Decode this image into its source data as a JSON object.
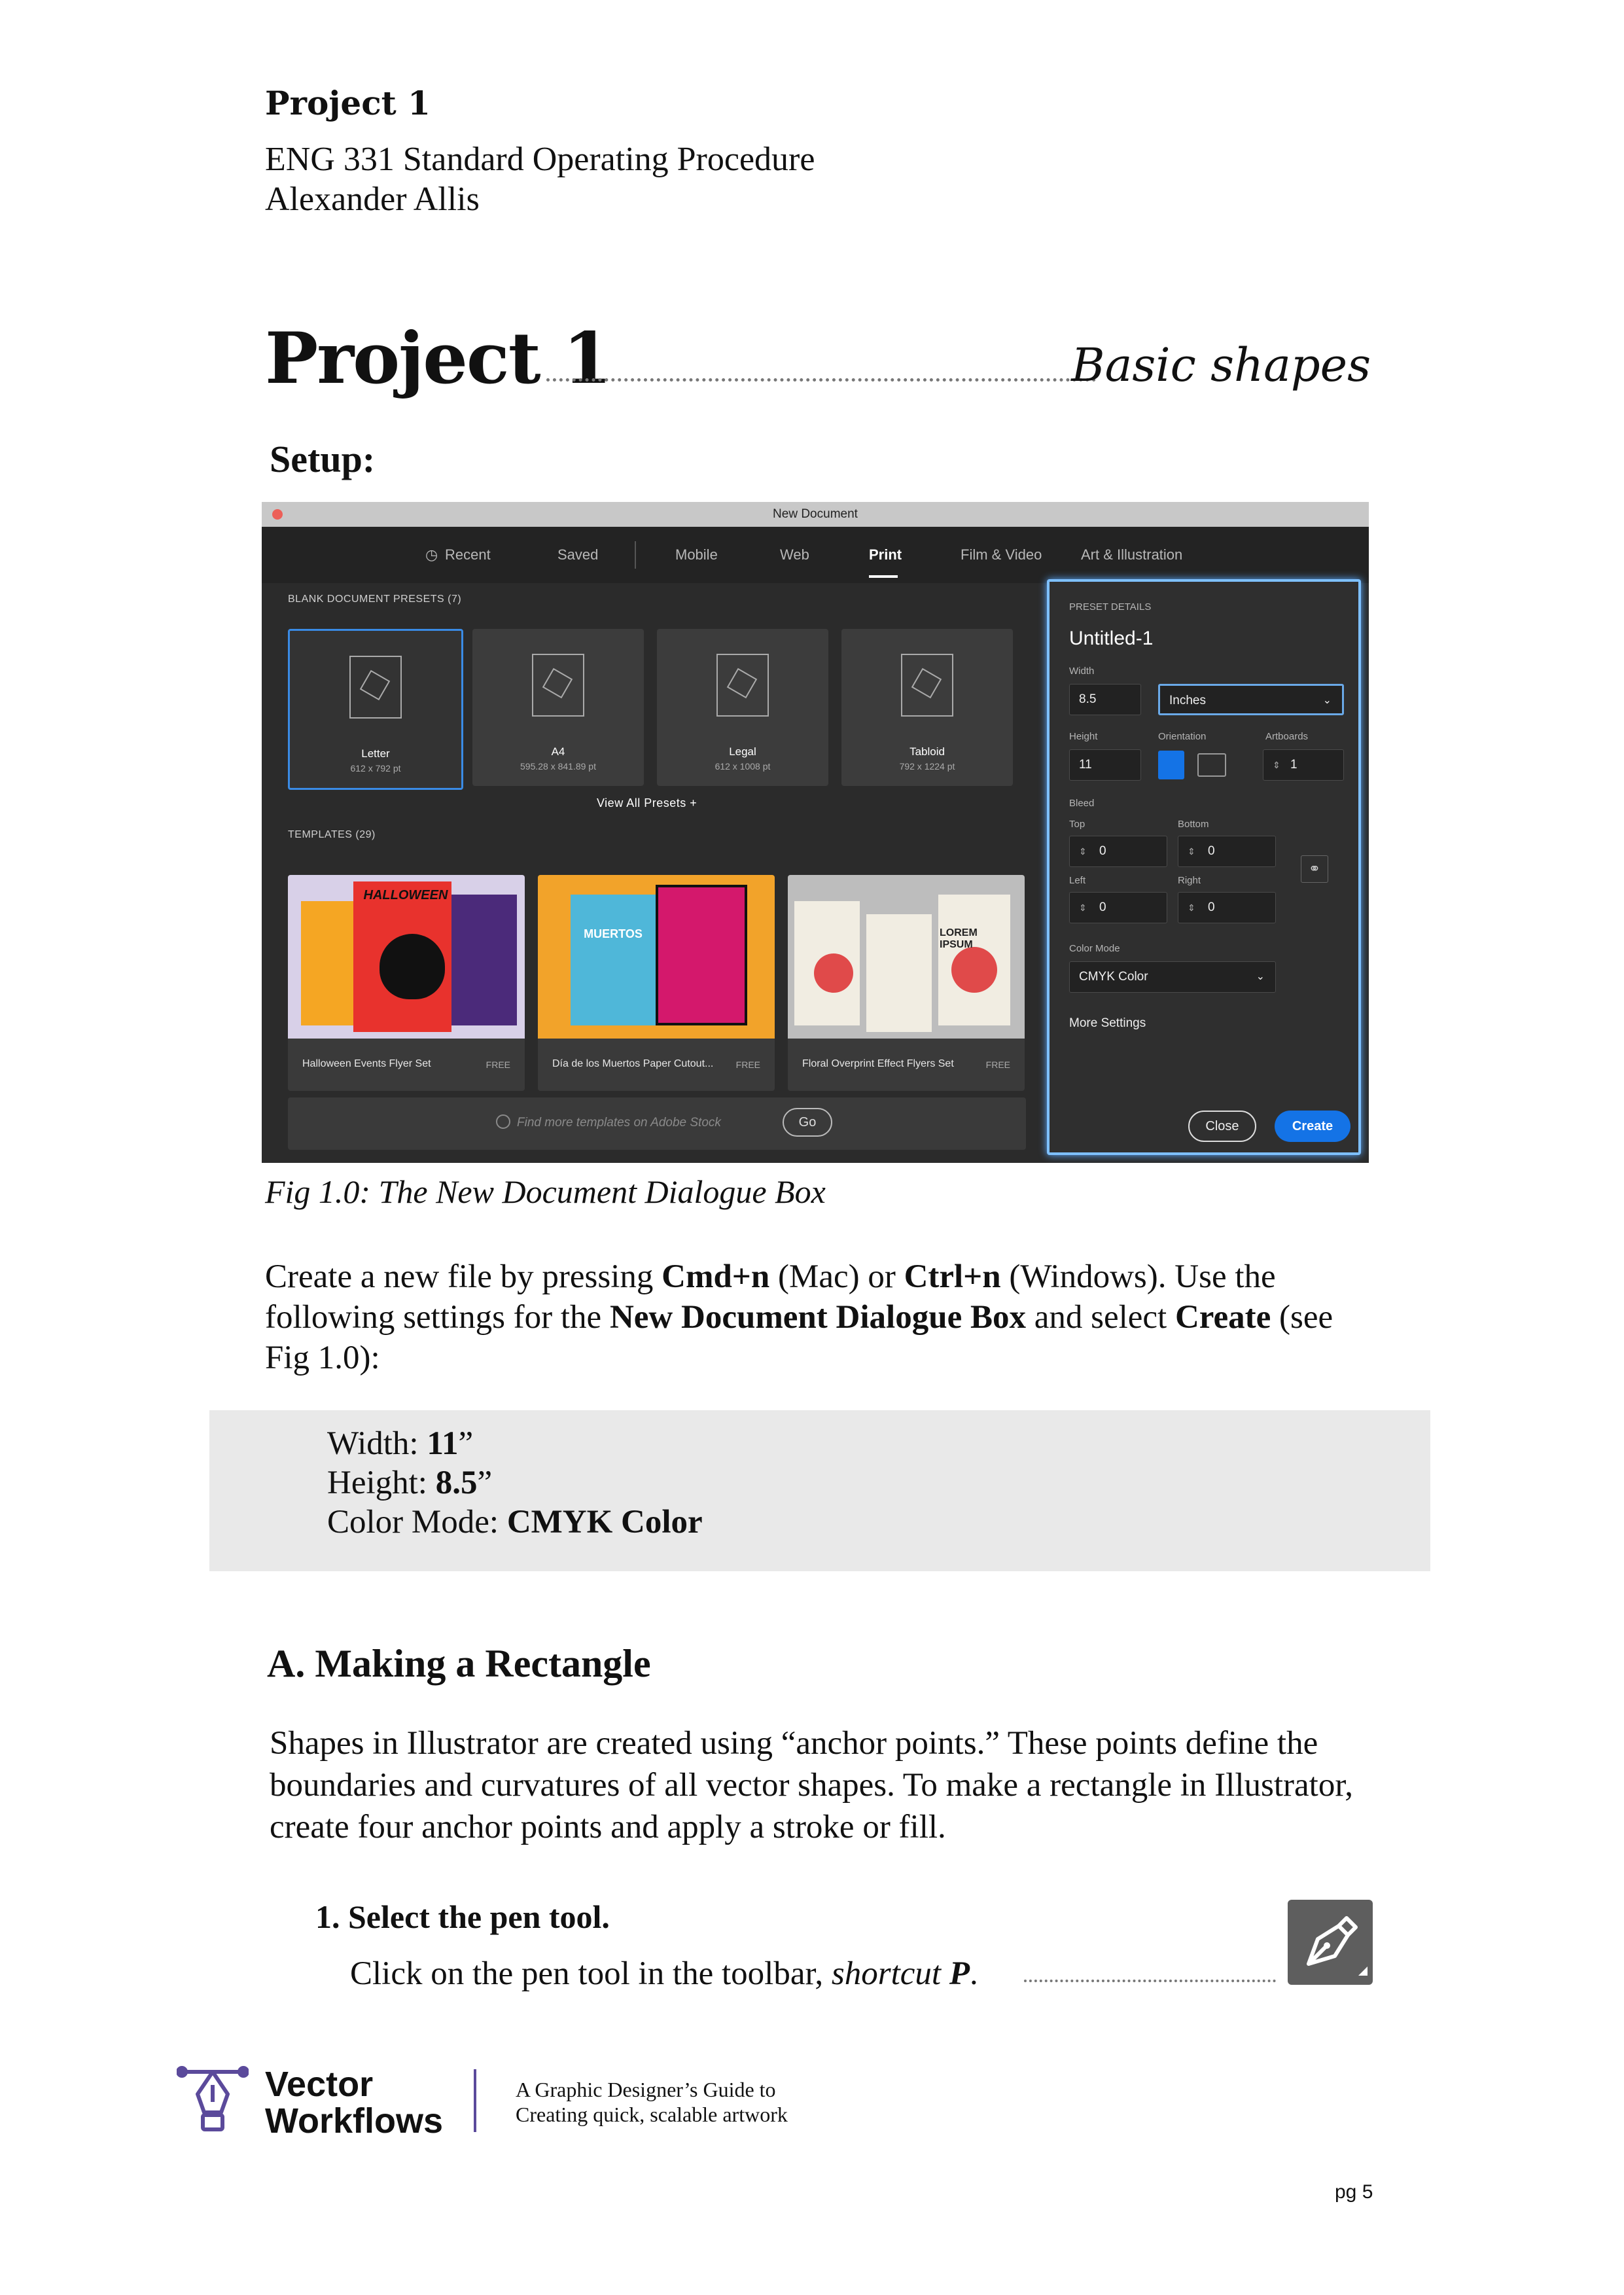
{
  "header": {
    "project": "Project 1",
    "course": "ENG 331 Standard Operating Procedure",
    "author": "Alexander Allis"
  },
  "title": {
    "main": "Project 1",
    "sub": "Basic shapes"
  },
  "setup_heading": "Setup:",
  "dialog": {
    "window_title": "New Document",
    "tabs": [
      "Recent",
      "Saved",
      "Mobile",
      "Web",
      "Print",
      "Film & Video",
      "Art & Illustration"
    ],
    "active_tab": "Print",
    "presets_label": "BLANK DOCUMENT PRESETS",
    "presets_count": "(7)",
    "presets": [
      {
        "name": "Letter",
        "size": "612 x 792 pt"
      },
      {
        "name": "A4",
        "size": "595.28 x 841.89 pt"
      },
      {
        "name": "Legal",
        "size": "612 x 1008 pt"
      },
      {
        "name": "Tabloid",
        "size": "792 x 1224 pt"
      }
    ],
    "view_all": "View All Presets  +",
    "templates_label": "TEMPLATES",
    "templates_count": "(29)",
    "templates": [
      {
        "name": "Halloween Events Flyer Set",
        "badge": "FREE",
        "art_text": "HALLOWEEN"
      },
      {
        "name": "Día de los Muertos Paper Cutout...",
        "badge": "FREE",
        "art_text": "MUERTOS"
      },
      {
        "name": "Floral Overprint Effect Flyers Set",
        "badge": "FREE",
        "art_text": "LOREM IPSUM"
      }
    ],
    "search_placeholder": "Find more templates on Adobe Stock",
    "go_label": "Go",
    "details": {
      "section_label": "PRESET DETAILS",
      "doc_name": "Untitled-1",
      "width_label": "Width",
      "width_value": "8.5",
      "units": "Inches",
      "height_label": "Height",
      "height_value": "11",
      "orientation_label": "Orientation",
      "artboards_label": "Artboards",
      "artboards_value": "1",
      "bleed_label": "Bleed",
      "top_label": "Top",
      "top_value": "0",
      "bottom_label": "Bottom",
      "bottom_value": "0",
      "left_label": "Left",
      "left_value": "0",
      "right_label": "Right",
      "right_value": "0",
      "color_mode_label": "Color Mode",
      "color_mode_value": "CMYK Color",
      "more_settings": "More Settings",
      "close_label": "Close",
      "create_label": "Create"
    }
  },
  "figure_caption": "Fig 1.0: The New Document Dialogue Box",
  "para1": {
    "t1": "Create a new file by pressing ",
    "b1": "Cmd+n",
    "t2": " (Mac) or ",
    "b2": "Ctrl+n",
    "t3": " (Windows). Use the following settings for the ",
    "b3": "New Document Dialogue Box",
    "t4": " and select ",
    "b4": "Create",
    "t5": " (see Fig 1.0):"
  },
  "settings_box": {
    "width_label": "Width: ",
    "width_value": "11",
    "height_label": "Height: ",
    "height_value": "8.5",
    "inch": "”",
    "color_label": "Color Mode: ",
    "color_value": "CMYK Color"
  },
  "section_a": "A. Making a Rectangle",
  "para2": "Shapes in Illustrator are created using “anchor points.” These points define the boundaries and curvatures of all vector shapes. To make a rectangle in Illustrator, create four anchor points and apply a stroke or fill.",
  "step1": {
    "title": "1. Select the pen tool.",
    "desc": "Click on the pen tool in the toolbar, ",
    "shortcut_label": "shortcut ",
    "shortcut_key": "P",
    "trail": "."
  },
  "footer": {
    "logo_line1": "Vector",
    "logo_line2": "Workflows",
    "tagline1": "A Graphic Designer’s Guide to",
    "tagline2": "Creating quick, scalable artwork",
    "page": "pg 5"
  },
  "colors": {
    "accent_blue": "#1473e6",
    "focus_glow": "#7ec0ff",
    "logo_purple": "#5b4a9b",
    "box_gray": "#e9e9e9"
  }
}
